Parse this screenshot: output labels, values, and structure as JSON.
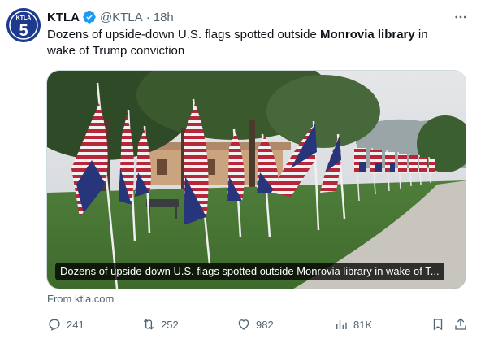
{
  "tweet": {
    "author_name": "KTLA",
    "handle": "@KTLA",
    "separator": "·",
    "time": "18h",
    "avatar_text": "KTLA 5",
    "text_before": "Dozens of upside-down U.S. flags spotted outside ",
    "text_bold": "Monrovia library",
    "text_after": " in wake of Trump conviction",
    "card_caption": "Dozens of upside-down U.S. flags spotted outside Monrovia library in wake of T...",
    "source": "From ktla.com"
  },
  "actions": {
    "replies": "241",
    "reposts": "252",
    "likes": "982",
    "views": "81K"
  },
  "colors": {
    "verified": "#1d9bf0",
    "secondary_text": "#536471",
    "avatar_bg": "#1d3b8e"
  },
  "icons": [
    "more-icon",
    "verified-icon",
    "reply-icon",
    "repost-icon",
    "like-icon",
    "views-icon",
    "bookmark-icon",
    "share-icon"
  ]
}
